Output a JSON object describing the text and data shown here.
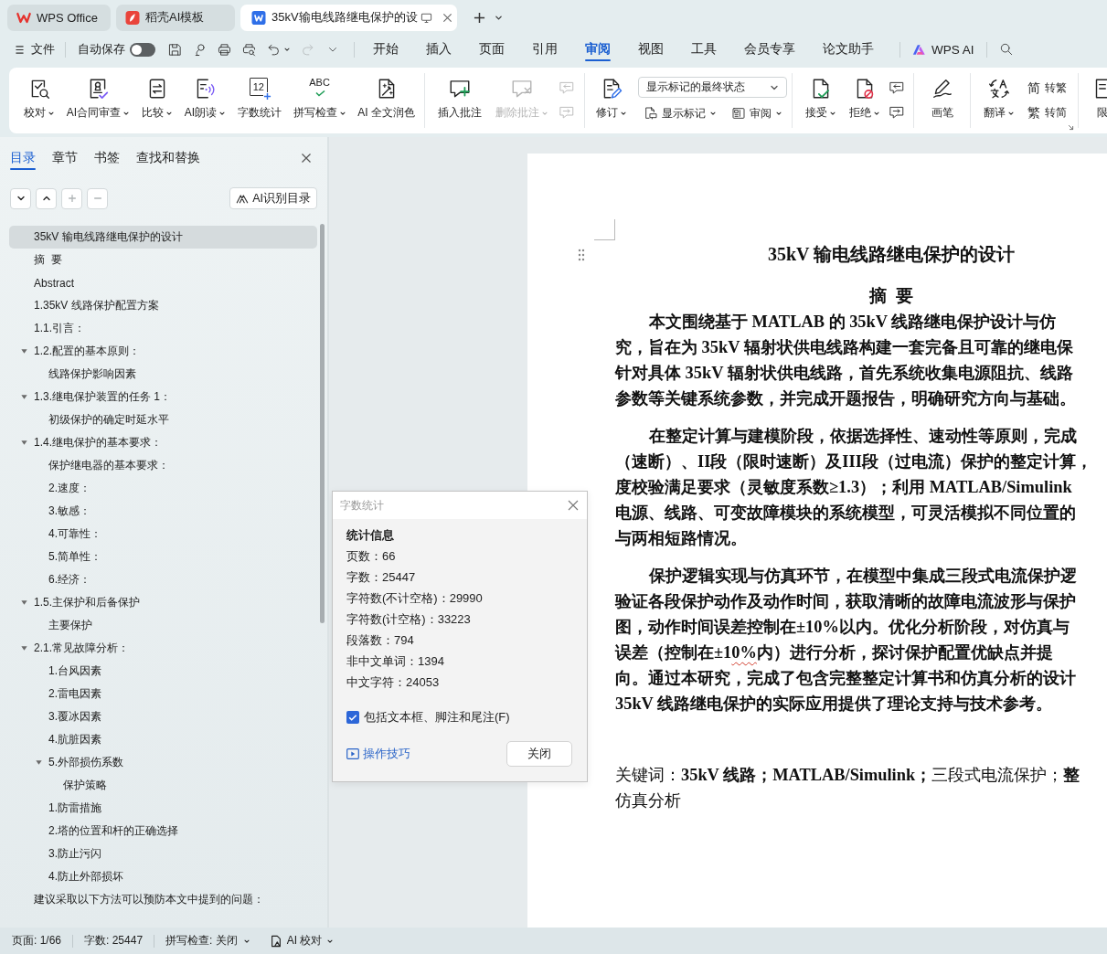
{
  "title_tabs": [
    {
      "label": "WPS Office",
      "kind": "home",
      "selected": false
    },
    {
      "label": "稻壳AI模板",
      "kind": "template",
      "selected": false
    },
    {
      "label": "35kV输电线路继电保护的设",
      "kind": "document",
      "selected": true
    }
  ],
  "menu_bar": {
    "file_menu": "文件",
    "autosave": {
      "label": "自动保存",
      "on": false
    },
    "quick_tools": [
      {
        "disabled": false,
        "has_menu": false
      },
      {
        "disabled": false,
        "has_menu": false
      },
      {
        "disabled": false,
        "has_menu": false
      },
      {
        "disabled": false,
        "has_menu": false
      },
      {
        "disabled": false,
        "has_menu": true
      },
      {
        "disabled": true,
        "has_menu": false
      }
    ],
    "tabs": [
      {
        "label": "开始",
        "selected": false
      },
      {
        "label": "插入",
        "selected": false
      },
      {
        "label": "页面",
        "selected": false
      },
      {
        "label": "引用",
        "selected": false
      },
      {
        "label": "审阅",
        "selected": true
      },
      {
        "label": "视图",
        "selected": false
      },
      {
        "label": "工具",
        "selected": false
      },
      {
        "label": "会员专享",
        "selected": false
      },
      {
        "label": "论文助手",
        "selected": false
      }
    ],
    "ai_button": "WPS AI"
  },
  "ribbon": {
    "groups": [
      {
        "items": [
          {
            "kind": "large",
            "label": "校对",
            "has_menu": true,
            "disabled": false
          },
          {
            "kind": "large",
            "label": "AI合同审查",
            "has_menu": true,
            "disabled": false
          },
          {
            "kind": "large",
            "label": "比较",
            "has_menu": true,
            "disabled": false
          },
          {
            "kind": "large",
            "label": "AI朗读",
            "has_menu": true,
            "disabled": false
          },
          {
            "kind": "large",
            "label": "字数统计",
            "glyph": "12",
            "has_menu": false,
            "disabled": false
          },
          {
            "kind": "large",
            "label": "拼写检查",
            "glyph": "ABC",
            "has_menu": true,
            "disabled": false
          },
          {
            "kind": "large",
            "label": "AI 全文润色",
            "has_menu": false,
            "disabled": false
          }
        ]
      },
      {
        "items": [
          {
            "kind": "large",
            "label": "插入批注",
            "has_menu": false,
            "disabled": false
          },
          {
            "kind": "large",
            "label": "删除批注",
            "has_menu": true,
            "disabled": true
          },
          {
            "kind": "stack",
            "buttons": [
              {
                "disabled": true
              },
              {
                "disabled": true
              }
            ]
          }
        ]
      },
      {
        "items": [
          {
            "kind": "large",
            "label": "修订",
            "has_menu": true,
            "disabled": false
          },
          {
            "kind": "markup",
            "select": {
              "value": "显示标记的最终状态"
            },
            "buttons": [
              {
                "label": "显示标记",
                "has_menu": true,
                "disabled": false
              },
              {
                "label": "审阅",
                "has_menu": true,
                "disabled": false
              }
            ]
          }
        ]
      },
      {
        "items": [
          {
            "kind": "large",
            "label": "接受",
            "has_menu": true,
            "disabled": false
          },
          {
            "kind": "large",
            "label": "拒绝",
            "has_menu": true,
            "disabled": false
          },
          {
            "kind": "stack",
            "buttons": [
              {
                "disabled": false
              },
              {
                "disabled": false
              }
            ]
          }
        ]
      },
      {
        "items": [
          {
            "kind": "large",
            "label": "画笔",
            "has_menu": false,
            "disabled": false
          }
        ]
      },
      {
        "items": [
          {
            "kind": "large",
            "label": "翻译",
            "has_menu": true,
            "disabled": false
          },
          {
            "kind": "stack",
            "buttons": [
              {
                "glyph": "简",
                "label": "转繁",
                "disabled": false
              },
              {
                "glyph": "繁",
                "label": "转简",
                "disabled": false
              }
            ]
          }
        ],
        "launcher": true
      },
      {
        "items": [
          {
            "kind": "large",
            "label": "限",
            "has_menu": false,
            "disabled": false
          }
        ]
      }
    ]
  },
  "navigation": {
    "tabs": [
      {
        "label": "目录",
        "selected": true
      },
      {
        "label": "章节",
        "selected": false
      },
      {
        "label": "书签",
        "selected": false
      },
      {
        "label": "查找和替换",
        "selected": false
      }
    ],
    "tools": [
      {
        "disabled": false
      },
      {
        "disabled": false
      },
      {
        "disabled": true
      },
      {
        "disabled": true
      }
    ],
    "ai_button": "AI识别目录",
    "outline": [
      {
        "label": "35kV 输电线路继电保护的设计",
        "selected": true
      },
      {
        "label": "摘  要",
        "selected": false
      },
      {
        "label": "Abstract",
        "selected": false
      },
      {
        "label": "1.35kV 线路保护配置方案",
        "selected": false
      },
      {
        "label": "1.1.引言：",
        "selected": false
      },
      {
        "label": "1.2.配置的基本原则：",
        "selected": false,
        "expanded": true,
        "children": [
          {
            "label": "线路保护影响因素",
            "selected": false
          }
        ]
      },
      {
        "label": "1.3.继电保护装置的任务 1：",
        "selected": false,
        "expanded": true,
        "children": [
          {
            "label": "初级保护的确定时延水平",
            "selected": false
          }
        ]
      },
      {
        "label": "1.4.继电保护的基本要求：",
        "selected": false,
        "expanded": true,
        "children": [
          {
            "label": "保护继电器的基本要求：",
            "selected": false
          },
          {
            "label": "2.速度：",
            "selected": false
          },
          {
            "label": "3.敏感：",
            "selected": false
          },
          {
            "label": "4.可靠性：",
            "selected": false
          },
          {
            "label": "5.简单性：",
            "selected": false
          },
          {
            "label": "6.经济：",
            "selected": false
          }
        ]
      },
      {
        "label": "1.5.主保护和后备保护",
        "selected": false,
        "expanded": true,
        "children": [
          {
            "label": "主要保护",
            "selected": false
          }
        ]
      },
      {
        "label": "2.1.常见故障分析：",
        "selected": false,
        "expanded": true,
        "children": [
          {
            "label": "1.台风因素",
            "selected": false
          },
          {
            "label": "2.雷电因素",
            "selected": false
          },
          {
            "label": "3.覆冰因素",
            "selected": false
          },
          {
            "label": "4.肮脏因素",
            "selected": false
          },
          {
            "label": "5.外部损伤系数",
            "selected": false,
            "expanded": true,
            "children": [
              {
                "label": "保护策略",
                "selected": false
              }
            ]
          },
          {
            "label": "1.防雷措施",
            "selected": false
          },
          {
            "label": "2.塔的位置和杆的正确选择",
            "selected": false
          },
          {
            "label": "3.防止污闪",
            "selected": false
          },
          {
            "label": "4.防止外部损坏",
            "selected": false
          }
        ]
      },
      {
        "label": "建议采取以下方法可以预防本文中提到的问题：",
        "selected": false
      }
    ]
  },
  "document": {
    "title": "35kV 输电线路继电保护的设计",
    "abstract_heading": "摘  要",
    "paragraphs": [
      {
        "lines": [
          {
            "text": "本文围绕基于 MATLAB 的 35kV 线路继电保护设计与仿"
          },
          {
            "text": "究，旨在为 35kV 辐射状供电线路构建一套完备且可靠的继电保"
          },
          {
            "text": "针对具体 35kV 辐射状供电线路，首先系统收集电源阻抗、线路"
          },
          {
            "text": "参数等关键系统参数，并完成开题报告，明确研究方向与基础。"
          }
        ]
      },
      {
        "lines": [
          {
            "text": "在整定计算与建模阶段，依据选择性、速动性等原则，完成"
          },
          {
            "text": "（速断）、II段（限时速断）及III段（过电流）保护的整定计算，"
          },
          {
            "text": "度校验满足要求（灵敏度系数≥1.3）；利用 MATLAB/Simulink"
          },
          {
            "text": "电源、线路、可变故障模块的系统模型，可灵活模拟不同位置的"
          },
          {
            "text": "与两相短路情况。"
          }
        ]
      },
      {
        "lines": [
          {
            "text": "保护逻辑实现与仿真环节，在模型中集成三段式电流保护逻"
          },
          {
            "text": "验证各段保护动作及动作时间，获取清晰的故障电流波形与保护"
          },
          {
            "text": "图，动作时间误差控制在±10%以内。优化分析阶段，对仿真与"
          },
          {
            "parts": [
              {
                "text": "误差（控制在±1",
                "flagged": false
              },
              {
                "text": "0%",
                "flagged": true
              },
              {
                "text": "内）进行分析，探讨保护配置优缺点并提",
                "flagged": false
              }
            ]
          },
          {
            "text": "向。通过本研究，完成了包含完整整定计算书和仿真分析的设计"
          },
          {
            "text": "35kV 线路继电保护的实际应用提供了理论支持与技术参考。"
          }
        ]
      }
    ],
    "keywords": {
      "lines": [
        {
          "text": "关键词：**35kV 线路；MATLAB/Simulink；**三段式电流保护；**整**"
        },
        {
          "text": "仿真分析"
        }
      ]
    }
  },
  "word_count_dialog": {
    "title": "字数统计",
    "heading": "统计信息",
    "stats": [
      "页数：66",
      "字数：25447",
      "字符数(不计空格)：29990",
      "字符数(计空格)：33223",
      "段落数：794",
      "非中文单词：1394",
      "中文字符：24053"
    ],
    "include_option": {
      "label": "包括文本框、脚注和尾注(F)",
      "checked": true
    },
    "tips_link": "操作技巧",
    "close_button": "关闭"
  },
  "status_bar": {
    "page": "页面: 1/66",
    "word_count": "字数: 25447",
    "spell_check": "拼写检查: 关闭",
    "ai_proof": "AI 校对"
  }
}
